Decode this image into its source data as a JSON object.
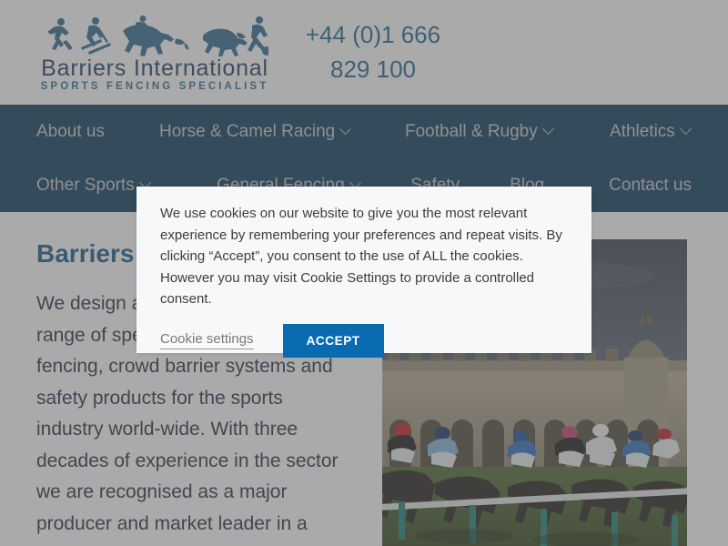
{
  "header": {
    "logo": {
      "name": "Barriers International",
      "tagline": "SPORTS FENCING SPECIALIST",
      "figures_icon": "sports-silhouettes-icon",
      "brand_color": "#1d6490"
    },
    "phone": "+44 (0)1 666 829 100"
  },
  "nav": {
    "background_color": "#0a3a5c",
    "text_color": "#c9c9c4",
    "row1": [
      {
        "label": "About us",
        "has_dropdown": false
      },
      {
        "label": "Horse & Camel Racing",
        "has_dropdown": true
      },
      {
        "label": "Football & Rugby",
        "has_dropdown": true
      },
      {
        "label": "Athletics",
        "has_dropdown": true
      }
    ],
    "row2": [
      {
        "label": "Other Sports",
        "has_dropdown": true
      },
      {
        "label": "General Fencing",
        "has_dropdown": true
      },
      {
        "label": "Safety",
        "has_dropdown": false
      },
      {
        "label": "Blog",
        "has_dropdown": false
      },
      {
        "label": "Contact us",
        "has_dropdown": false
      }
    ]
  },
  "main": {
    "title": "Barriers International",
    "body": "We design and manufacture a wide range of specialist PVC horse racing fencing, crowd barrier systems and safety products for the sports industry world-wide. With three decades of experience in the sector we are recognised as a major producer and market leader in a",
    "photo_alt": "Horse race in progress past a grandstand with white running rail"
  },
  "cookie_dialog": {
    "message": "We use cookies on our website to give you the most relevant experience by remembering your preferences and repeat visits. By clicking “Accept”, you consent to the use of ALL the cookies. However you may visit Cookie Settings to provide a controlled consent.",
    "settings_label": "Cookie settings",
    "accept_label": "ACCEPT",
    "accept_color": "#0a6cb0"
  }
}
